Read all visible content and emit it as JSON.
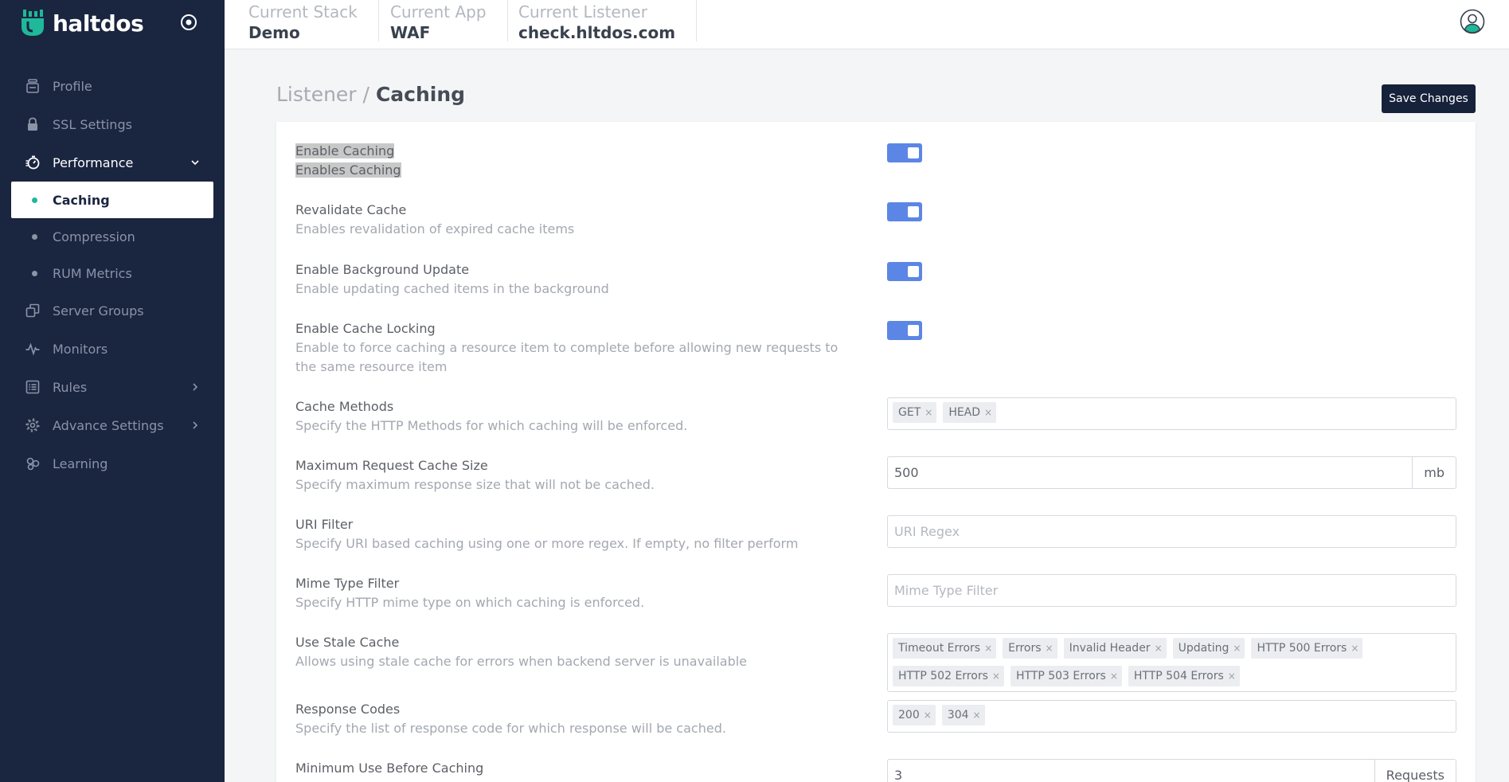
{
  "brand": {
    "name": "haltdos"
  },
  "sidebar": {
    "items": [
      {
        "label": "Profile",
        "icon": "profile-icon"
      },
      {
        "label": "SSL Settings",
        "icon": "lock-icon"
      },
      {
        "label": "Performance",
        "icon": "performance-icon"
      },
      {
        "label": "Server Groups",
        "icon": "server-groups-icon"
      },
      {
        "label": "Monitors",
        "icon": "pulse-icon"
      },
      {
        "label": "Rules",
        "icon": "rules-icon"
      },
      {
        "label": "Advance Settings",
        "icon": "gear-icon"
      },
      {
        "label": "Learning",
        "icon": "learning-icon"
      }
    ],
    "performance_sub": [
      "Caching",
      "Compression",
      "RUM Metrics"
    ]
  },
  "header": {
    "stack_label": "Current Stack",
    "stack_value": "Demo",
    "app_label": "Current App",
    "app_value": "WAF",
    "listener_label": "Current Listener",
    "listener_value": "check.hltdos.com"
  },
  "page": {
    "crumb_parent": "Listener",
    "crumb_sep": "/",
    "crumb_current": "Caching",
    "save_label": "Save Changes"
  },
  "settings": {
    "enable_caching": {
      "label": "Enable Caching",
      "desc": "Enables Caching",
      "on": true
    },
    "revalidate": {
      "label": "Revalidate Cache",
      "desc": "Enables revalidation of expired cache items",
      "on": true
    },
    "bg_update": {
      "label": "Enable Background Update",
      "desc": "Enable updating cached items in the background",
      "on": true
    },
    "locking": {
      "label": "Enable Cache Locking",
      "desc": "Enable to force caching a resource item to complete before allowing new requests to the same resource item",
      "on": true
    },
    "methods": {
      "label": "Cache Methods",
      "desc": "Specify the HTTP Methods for which caching will be enforced.",
      "tags": [
        "GET",
        "HEAD"
      ]
    },
    "max_size": {
      "label": "Maximum Request Cache Size",
      "desc": "Specify maximum response size that will not be cached.",
      "value": "500",
      "unit": "mb"
    },
    "uri_filter": {
      "label": "URI Filter",
      "desc": "Specify URI based caching using one or more regex. If empty, no filter perform",
      "placeholder": "URI Regex"
    },
    "mime_filter": {
      "label": "Mime Type Filter",
      "desc": "Specify HTTP mime type on which caching is enforced.",
      "placeholder": "Mime Type Filter"
    },
    "stale": {
      "label": "Use Stale Cache",
      "desc": "Allows using stale cache for errors when backend server is unavailable",
      "tags": [
        "Timeout Errors",
        "Errors",
        "Invalid Header",
        "Updating",
        "HTTP 500 Errors",
        "HTTP 502 Errors",
        "HTTP 503 Errors",
        "HTTP 504 Errors"
      ]
    },
    "codes": {
      "label": "Response Codes",
      "desc": "Specify the list of response code for which response will be cached.",
      "tags": [
        "200",
        "304"
      ]
    },
    "min_use": {
      "label": "Minimum Use Before Caching",
      "value": "3",
      "unit": "Requests"
    }
  },
  "colors": {
    "sidebar_bg": "#1a2540",
    "toggle_on": "#5b86e5",
    "active_dot": "#1fb89a",
    "save_btn": "#16213a"
  }
}
